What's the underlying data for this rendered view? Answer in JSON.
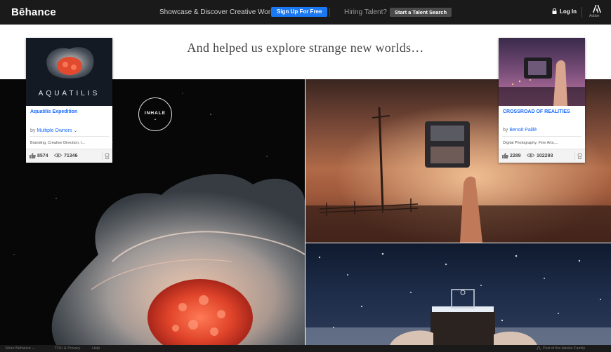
{
  "header": {
    "logo": "Bēhance",
    "tagline": "Showcase & Discover Creative Work",
    "signup_label": "Sign Up For Free",
    "hiring_text": "Hiring Talent?",
    "talent_search_label": "Start a Talent Search",
    "login_label": "Log In",
    "adobe_label": "Adobe"
  },
  "headline": "And helped us explore strange new worlds…",
  "inhale": {
    "label": "INHALE",
    "chevron": "⌄"
  },
  "cards": [
    {
      "thumb_text": "AQUATILIS",
      "title": "Aquatilis Expedition",
      "by_prefix": "by",
      "owner": "Multiple Owners",
      "owner_chevron": "⌄",
      "fields": "Branding, Creative Direction, I...",
      "appreciations": "8574",
      "views": "71346"
    },
    {
      "title": "CROSSROAD OF REALITIES",
      "by_prefix": "by",
      "owner": "Benoit Paillé",
      "fields": "Digital Photography, Fine Arts,...",
      "appreciations": "2289",
      "views": "102293"
    }
  ],
  "footer": {
    "more": "More Behance",
    "more_chevron": "⌄",
    "tou": "TOU & Privacy",
    "help": "Help",
    "family": "Part of the Adobe Family"
  },
  "colors": {
    "topbar": "#1a1a1a",
    "accent_blue": "#1769ff",
    "signup_button": "#1a78f2"
  }
}
